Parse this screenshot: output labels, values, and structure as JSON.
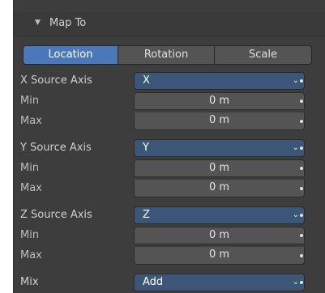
{
  "panel": {
    "title": "Map To",
    "arrow": "▼"
  },
  "tabs": [
    {
      "label": "Location",
      "active": true
    },
    {
      "label": "Rotation",
      "active": false
    },
    {
      "label": "Scale",
      "active": false
    }
  ],
  "axes": {
    "x": {
      "label": "X Source Axis",
      "value": "X",
      "min_label": "Min",
      "min": "0 m",
      "max_label": "Max",
      "max": "0 m"
    },
    "y": {
      "label": "Y Source Axis",
      "value": "Y",
      "min_label": "Min",
      "min": "0 m",
      "max_label": "Max",
      "max": "0 m"
    },
    "z": {
      "label": "Z Source Axis",
      "value": "Z",
      "min_label": "Min",
      "min": "0 m",
      "max_label": "Max",
      "max": "0 m"
    }
  },
  "mix": {
    "label": "Mix",
    "value": "Add"
  },
  "icons": {
    "chevron": "⌄",
    "dot": "decorate-dot"
  },
  "colors": {
    "panel_bg": "#3d3d3d",
    "accent": "#4b78b8",
    "dropdown_bg": "#3c5677",
    "field_bg": "#545454"
  }
}
